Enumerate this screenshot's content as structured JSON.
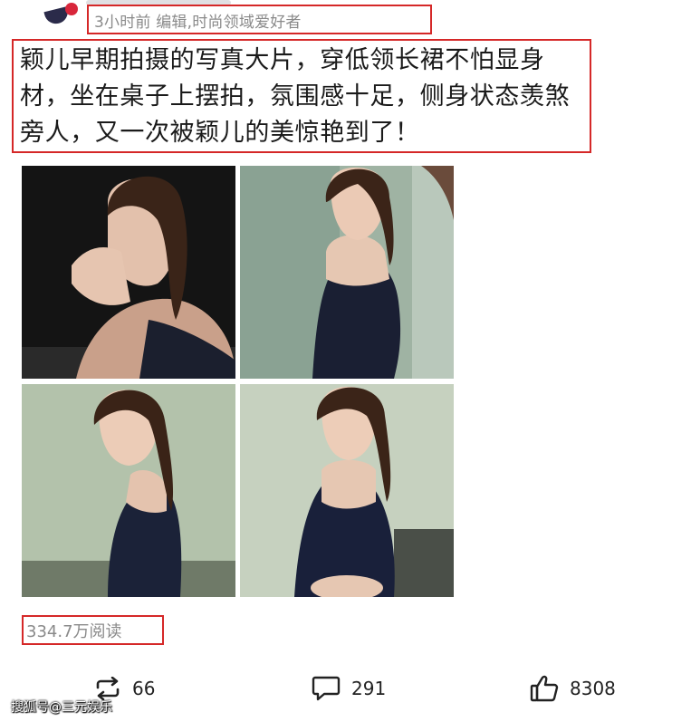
{
  "post": {
    "meta": "3小时前  编辑,时尚领域爱好者",
    "caption": "颖儿早期拍摄的写真大片，穿低领长裙不怕显身材，坐在桌子上摆拍，氛围感十足，侧身状态羡煞旁人，又一次被颖儿的美惊艳到了！",
    "reads": "334.7万阅读"
  },
  "actions": {
    "repost_count": "66",
    "comment_count": "291",
    "like_count": "8308",
    "repost_icon": "repost-icon",
    "comment_icon": "comment-icon",
    "like_icon": "thumbs-up-icon"
  },
  "watermark": "搜狐号@三元娱乐",
  "colors": {
    "highlight_border": "#d52828",
    "meta_text": "#8a8a8a"
  }
}
